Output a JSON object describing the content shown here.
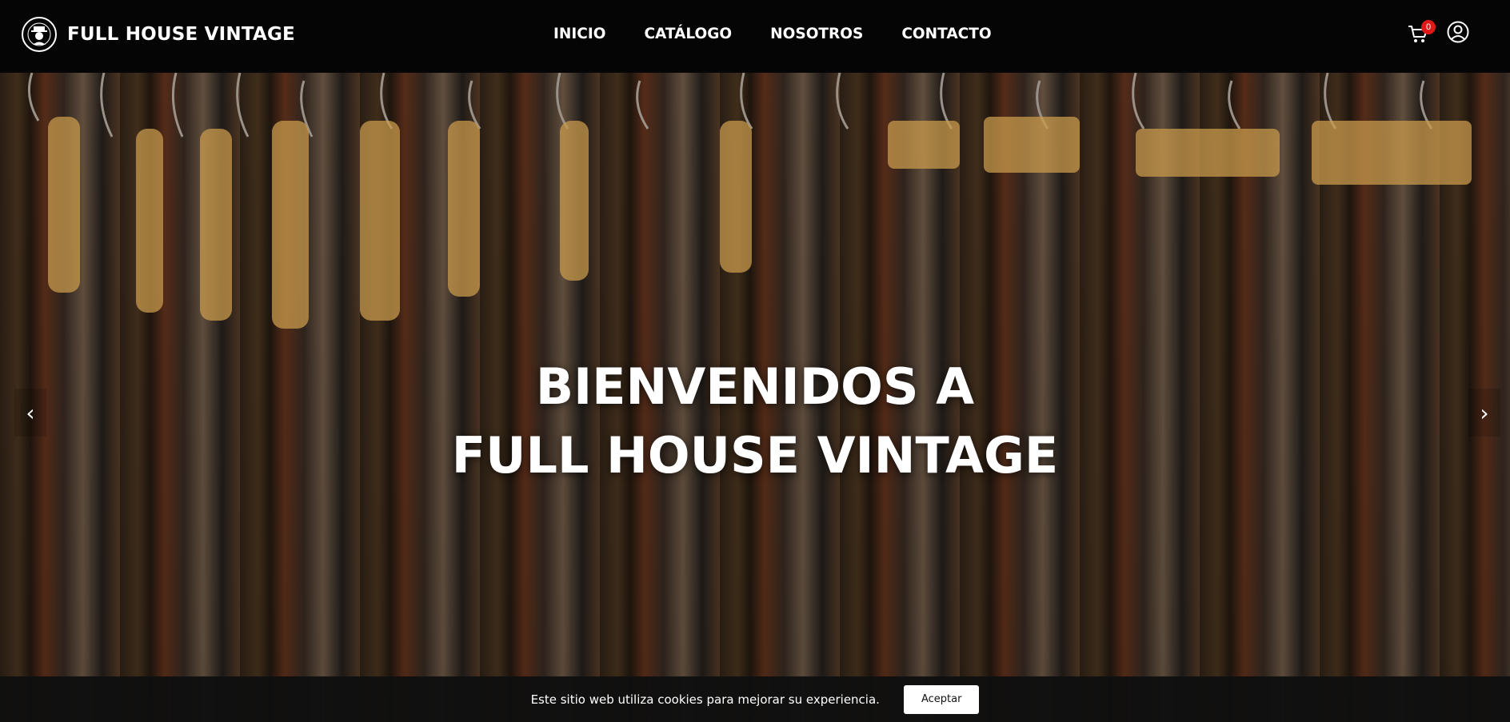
{
  "brand": {
    "name": "FULL HOUSE VINTAGE",
    "logo_icon": "vintage-seal-logo"
  },
  "nav": {
    "items": [
      {
        "label": "INICIO"
      },
      {
        "label": "CATÁLOGO"
      },
      {
        "label": "NOSOTROS"
      },
      {
        "label": "CONTACTO"
      }
    ]
  },
  "header_icons": {
    "cart_icon": "shopping-cart-icon",
    "cart_count": "0",
    "user_icon": "user-account-icon"
  },
  "hero": {
    "title_line1": "BIENVENIDOS A",
    "title_line2": "FULL HOUSE VINTAGE",
    "prev_label": "‹",
    "next_label": "›"
  },
  "cookie": {
    "message": "Este sitio web utiliza cookies para mejorar su experiencia.",
    "accept_label": "Aceptar"
  },
  "colors": {
    "navbar_bg": "#050505",
    "badge": "#e01818",
    "cookie_bg": "#101010",
    "accept_bg": "#ffffff"
  }
}
